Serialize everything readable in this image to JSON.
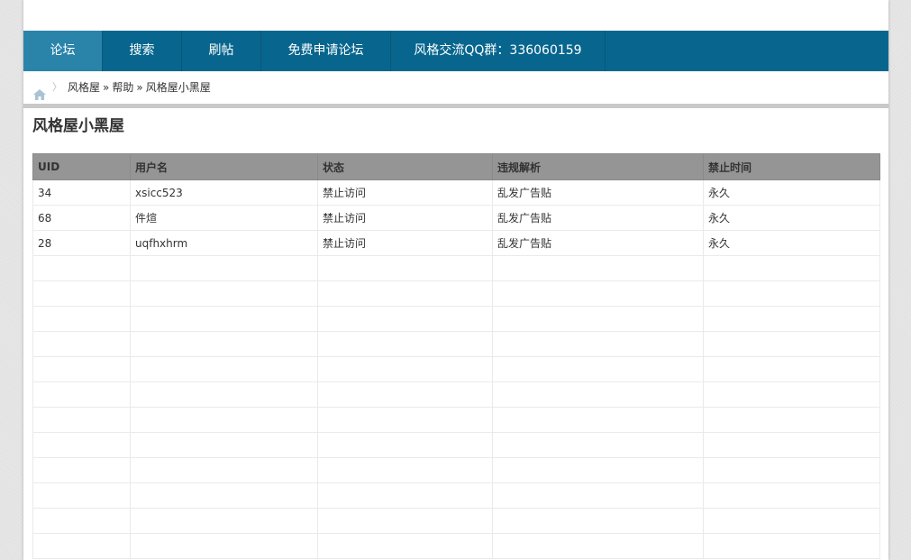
{
  "nav": {
    "items": [
      {
        "label": "论坛"
      },
      {
        "label": "搜索"
      },
      {
        "label": "刷帖"
      },
      {
        "label": "免费申请论坛"
      },
      {
        "label": "风格交流QQ群：336060159"
      }
    ]
  },
  "breadcrumb": {
    "items": [
      "风格屋",
      "帮助",
      "风格屋小黑屋"
    ],
    "separator": "»"
  },
  "page": {
    "title": "风格屋小黑屋"
  },
  "table": {
    "headers": [
      "UID",
      "用户名",
      "状态",
      "违规解析",
      "禁止时间"
    ],
    "rows": [
      [
        "34",
        "xsicc523",
        "禁止访问",
        "乱发广告贴",
        "永久"
      ],
      [
        "68",
        "件煊",
        "禁止访问",
        "乱发广告贴",
        "永久"
      ],
      [
        "28",
        "uqfhxhrm",
        "禁止访问",
        "乱发广告贴",
        "永久"
      ]
    ]
  },
  "colors": {
    "nav_bg": "#08668e",
    "nav_active": "#2a84aa",
    "table_header_bg": "#959595"
  }
}
